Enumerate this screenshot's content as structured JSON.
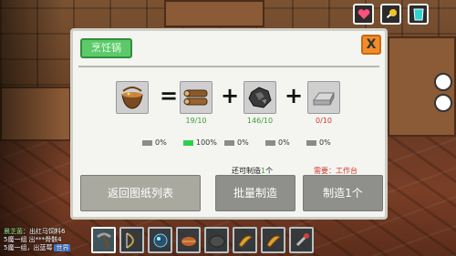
{
  "dialog": {
    "title": "烹饪锅",
    "close_label": "X",
    "recipe": {
      "result_icon": "cooking-pot-icon",
      "equals": "=",
      "plus": "+",
      "ingredients": [
        {
          "icon": "wood-log-icon",
          "count": "19/10",
          "status": "ok"
        },
        {
          "icon": "coal-ore-icon",
          "count": "146/10",
          "status": "ok"
        },
        {
          "icon": "iron-ingot-icon",
          "count": "0/10",
          "status": "missing"
        }
      ]
    },
    "progress": [
      "0%",
      "100%",
      "0%",
      "0%",
      "0%"
    ],
    "can_make_prefix": "还可制造",
    "can_make_count": "1",
    "can_make_suffix": "个",
    "requirement": "需要：工作台",
    "buttons": {
      "back": "返回图纸列表",
      "batch": "批量制造",
      "make_one": "制造1个"
    }
  },
  "hud": {
    "top_icons": [
      "heart-icon",
      "drumstick-icon",
      "water-cup-icon"
    ],
    "chat": [
      {
        "nick": "晨芝菌",
        "text": "出红马饲料6"
      },
      {
        "nick": "",
        "text": "5魔一组 出***骨骸4"
      },
      {
        "nick": "",
        "text": "5魔一组，出蓝莓",
        "tag": "世界"
      }
    ],
    "hotbar": [
      "pickaxe-icon",
      "bow-icon",
      "orb-icon",
      "shell-icon",
      "stone-icon",
      "horn-icon",
      "horn-icon",
      "wrench-icon"
    ]
  },
  "colors": {
    "title_bg": "#5ec96b",
    "close_bg": "#f08c2a",
    "ok": "#3f9d3a",
    "bad": "#d23a2b",
    "bar_full": "#2bd14a"
  }
}
